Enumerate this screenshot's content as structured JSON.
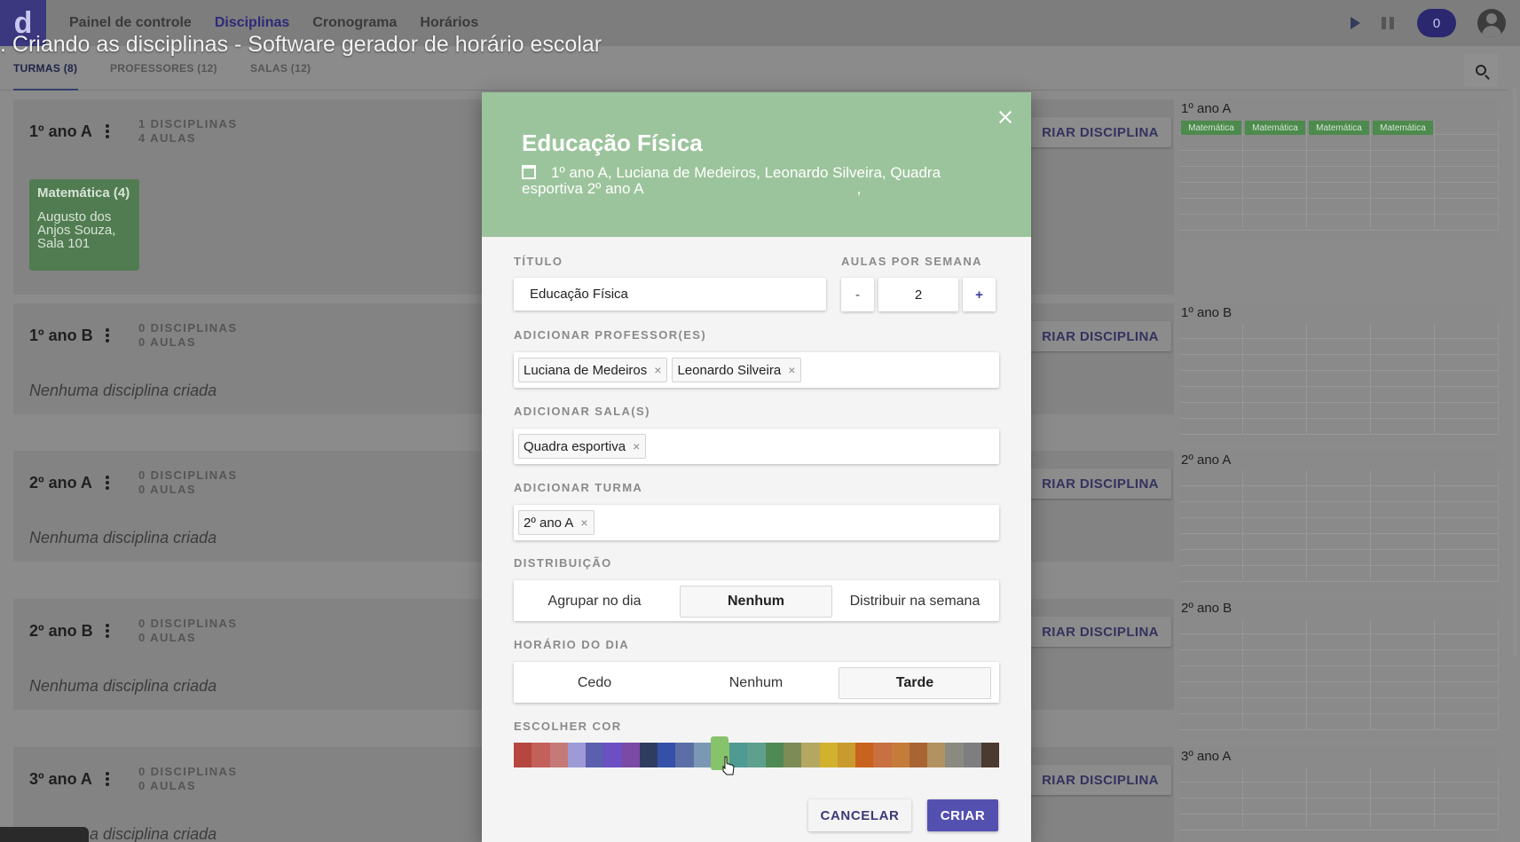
{
  "nav": {
    "logo": "d",
    "items": [
      "Painel de controle",
      "Disciplinas",
      "Cronograma",
      "Horários"
    ],
    "counter": "0"
  },
  "video_title": ". Criando as disciplinas - Software gerador de horário escolar",
  "tabs": [
    "TURMAS (8)",
    "PROFESSORES (12)",
    "SALAS (12)"
  ],
  "classes": [
    {
      "name": "1º ano A",
      "disciplines": "1 DISCIPLINAS",
      "lessons": "4 AULAS",
      "create": "RIAR DISCIPLINA"
    },
    {
      "name": "1º ano B",
      "disciplines": "0 DISCIPLINAS",
      "lessons": "0 AULAS",
      "empty": "Nenhuma disciplina criada",
      "create": "RIAR DISCIPLINA"
    },
    {
      "name": "2º ano A",
      "disciplines": "0 DISCIPLINAS",
      "lessons": "0 AULAS",
      "empty": "Nenhuma disciplina criada",
      "create": "RIAR DISCIPLINA"
    },
    {
      "name": "2º ano B",
      "disciplines": "0 DISCIPLINAS",
      "lessons": "0 AULAS",
      "empty": "Nenhuma disciplina criada",
      "create": "RIAR DISCIPLINA"
    },
    {
      "name": "3º ano A",
      "disciplines": "0 DISCIPLINAS",
      "lessons": "0 AULAS",
      "empty": "Nenhuma disciplina criada",
      "create": "RIAR DISCIPLINA"
    }
  ],
  "subject_card": {
    "title": "Matemática (4)",
    "detail": "Augusto dos Anjos Souza, Sala 101"
  },
  "grids": [
    {
      "title": "1º ano A",
      "chip": "Matemática"
    },
    {
      "title": "1º ano B"
    },
    {
      "title": "2º ano A"
    },
    {
      "title": "2º ano B"
    },
    {
      "title": "3º ano A"
    }
  ],
  "modal": {
    "title": "Educação Física",
    "subtitle": "1º ano A, Luciana de Medeiros, Leonardo Silveira, Quadra esportiva  2º ano A",
    "subtitle_trail": ",",
    "titulo_label": "TÍTULO",
    "titulo_value": "Educação Física",
    "aulas_label": "AULAS POR SEMANA",
    "aulas_value": "2",
    "minus": "-",
    "plus": "+",
    "prof_label": "ADICIONAR PROFESSOR(ES)",
    "professors": [
      "Luciana de Medeiros",
      "Leonardo Silveira"
    ],
    "sala_label": "ADICIONAR SALA(S)",
    "rooms": [
      "Quadra esportiva"
    ],
    "turma_label": "ADICIONAR TURMA",
    "turmas": [
      "2º ano A"
    ],
    "chip_remove": "×",
    "dist_label": "DISTRIBUIÇÃO",
    "dist_options": [
      "Agrupar no dia",
      "Nenhum",
      "Distribuir na semana"
    ],
    "dist_selected": "Nenhum",
    "hora_label": "HORÁRIO DO DIA",
    "hora_options": [
      "Cedo",
      "Nenhum",
      "Tarde"
    ],
    "hora_selected": "Tarde",
    "cor_label": "ESCOLHER COR",
    "palette": [
      "#b5473f",
      "#c4605a",
      "#c67a78",
      "#9d9ad6",
      "#5a5fae",
      "#6b4fc3",
      "#7b4aa4",
      "#2e3c5f",
      "#3550a8",
      "#5b6fa6",
      "#7a98b3",
      "#86c36a",
      "#4f9a93",
      "#5ea08d",
      "#4f8a55",
      "#7d8b57",
      "#b3a762",
      "#d2b12f",
      "#c99a2d",
      "#c8621e",
      "#c87041",
      "#c57c3a",
      "#a86533",
      "#b39261",
      "#8a8a80",
      "#7e7e7e",
      "#4a3a30"
    ],
    "selected_color": "#86c36a",
    "cancel": "CANCELAR",
    "create": "CRIAR"
  }
}
